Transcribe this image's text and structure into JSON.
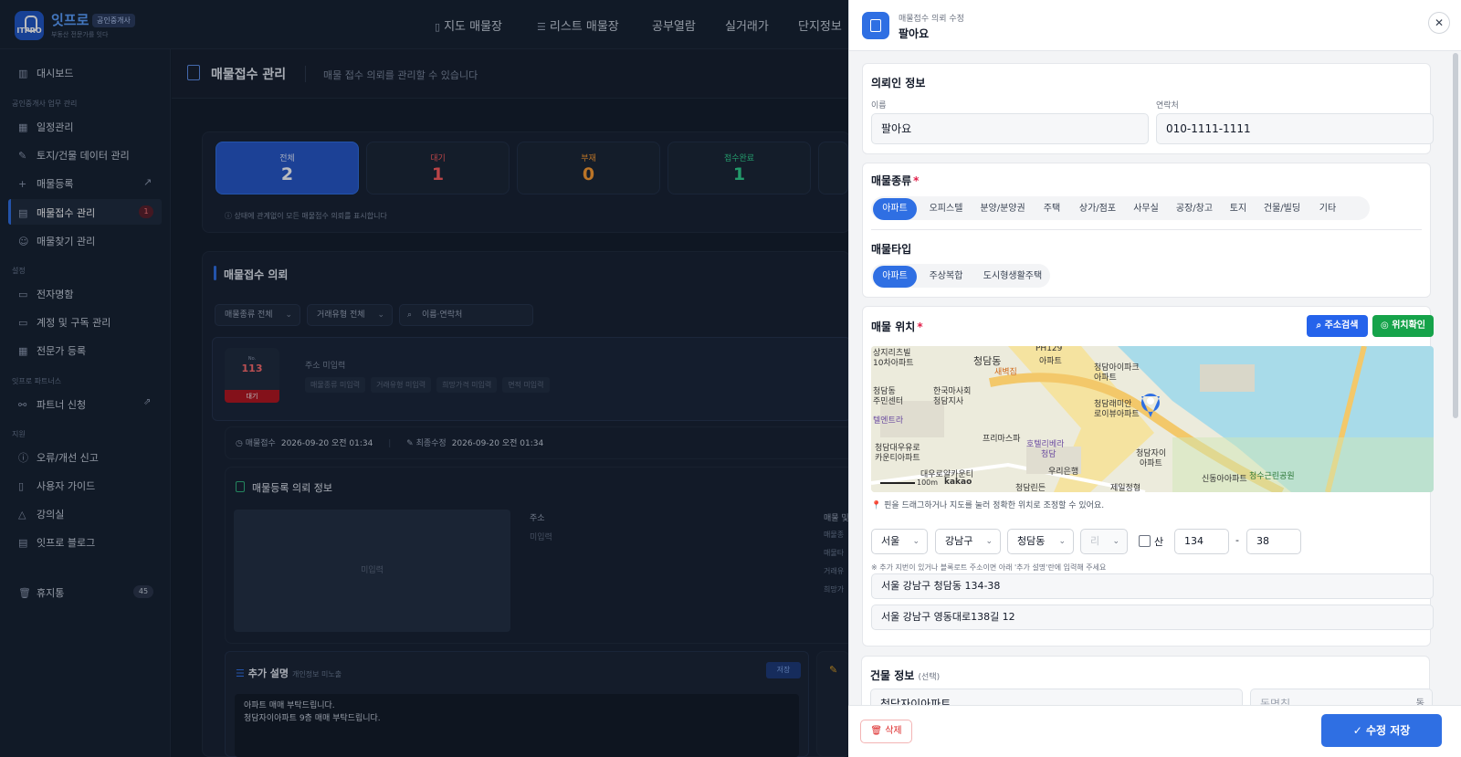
{
  "brand": {
    "name": "잇프로",
    "badge": "공인중개사",
    "tagline": "부동산 전문가를 잇다",
    "logo_text": "ITPRO"
  },
  "nav": [
    {
      "label": "지도 매물장",
      "icon": "map-icon"
    },
    {
      "label": "리스트 매물장",
      "icon": "list-icon"
    },
    {
      "label": "공부열람",
      "icon": ""
    },
    {
      "label": "실거래가",
      "icon": ""
    },
    {
      "label": "단지정보",
      "icon": ""
    }
  ],
  "sidebar": {
    "dashboard": "대시보드",
    "section_work": "공인중개사 업무 관리",
    "items": [
      "일정관리",
      "토지/건물 데이터 관리",
      "매물등록",
      "매물접수 관리",
      "매물찾기 관리"
    ],
    "intake_badge": "1",
    "section_settings": "설정",
    "settings": [
      "전자명함",
      "계정 및 구독 관리",
      "전문가 등록"
    ],
    "section_partners": "잇프로 파트너스",
    "partner": "파트너 신청",
    "section_support": "지원",
    "support": [
      "오류/개선 신고",
      "사용자 가이드",
      "강의실",
      "잇프로 블로그"
    ],
    "trash": "휴지통",
    "trash_badge": "45"
  },
  "page": {
    "title": "매물접수 관리",
    "subtitle": "매물 접수 의뢰를 관리할 수 있습니다"
  },
  "stats": [
    {
      "label": "전체",
      "value": "2",
      "color": "#ffffff"
    },
    {
      "label": "대기",
      "value": "1",
      "color": "#ff5a5a"
    },
    {
      "label": "부재",
      "value": "0",
      "color": "#ff9d2e"
    },
    {
      "label": "접수완료",
      "value": "1",
      "color": "#2fd28c"
    }
  ],
  "stats_note": "상태에 관계없이 모든 매물접수 의뢰를 표시합니다",
  "list": {
    "title": "매물접수 의뢰",
    "filter_type": "매물종류 전체",
    "filter_deal": "거래유형 전체",
    "search_placeholder": "이름·연락처"
  },
  "request_card": {
    "no_label": "No.",
    "no": "113",
    "status": "대기",
    "addr_title": "주소 미입력",
    "chips": [
      "매물종류 미입력",
      "거래유형 미입력",
      "희망가격 미입력",
      "면적 미입력"
    ]
  },
  "dates": {
    "received_label": "매물접수",
    "received": "2026-09-20 오전 01:34",
    "modified_label": "최종수정",
    "modified": "2026-09-20 오전 01:34"
  },
  "detail": {
    "title": "매물등록 의뢰 정보",
    "no_image": "미입력",
    "addr_label": "주소",
    "addr_value": "미입력",
    "right_label": "매물 및",
    "right_items": [
      "매물종",
      "매물타",
      "거래유",
      "희망가"
    ]
  },
  "extra": {
    "title": "추가 설명",
    "sub": "개인정보 미노출",
    "save": "저장",
    "text_lines": [
      "아파트 매매 부탁드립니다.",
      "청담자이아파트 9층 매매 부탁드립니다."
    ]
  },
  "drawer": {
    "subtitle": "매물접수 의뢰 수정",
    "title": "팔아요",
    "requester": {
      "title": "의뢰인 정보",
      "name_label": "이름",
      "name": "팔아요",
      "phone_label": "연락처",
      "phone": "010-1111-1111"
    },
    "type": {
      "title": "매물종류",
      "options": [
        "아파트",
        "오피스텔",
        "분양/분양권",
        "주택",
        "상가/점포",
        "사무실",
        "공장/창고",
        "토지",
        "건물/빌딩",
        "기타"
      ],
      "selected": "아파트"
    },
    "subtype": {
      "title": "매물타입",
      "options": [
        "아파트",
        "주상복합",
        "도시형생활주택"
      ],
      "selected": "아파트"
    },
    "location": {
      "title": "매물 위치",
      "search_btn": "주소검색",
      "confirm_btn": "위치확인",
      "hint": "핀을 드래그하거나 지도를 눌러 정확한 위치로 조정할 수 있어요.",
      "sido": "서울",
      "gu": "강남구",
      "dong": "청담동",
      "ri": "리",
      "san": "산",
      "bunji1": "134",
      "bunji2": "38",
      "dash": "-",
      "note": "※ 추가 지번이 있거나 블록로트 주소이면 아래 '추가 설명'란에 입력해 주세요",
      "jibun": "서울 강남구 청담동 134-38",
      "road": "서울 강남구 영동대로138길 12"
    },
    "map_labels": [
      "상지리츠빌",
      "10차아파트",
      "청담동",
      "PH129",
      "아파트",
      "새벽집",
      "청담아이파크",
      "아파트",
      "청담동",
      "주민센터",
      "한국마사회",
      "청담지사",
      "청담래미안",
      "로이뷰아파트",
      "텔엔트라",
      "프리마스파",
      "호텔리베라",
      "청담",
      "청담대우유로",
      "카운티아파트",
      "청담자이",
      "아파트",
      "대우로얄카운티",
      "우리은행",
      "신동아아파트",
      "청수근린공원",
      "청담린든",
      "제일정형",
      "100m",
      "kakao"
    ],
    "building": {
      "title": "건물 정보",
      "optional": "(선택)",
      "name": "청담자이아파트",
      "dong_placeholder": "동명칭",
      "dong_suffix": "동"
    },
    "delete_btn": "삭제",
    "save_btn": "수정 저장"
  },
  "colors": {
    "accent": "#2f6fe3",
    "green": "#16a34a",
    "danger": "#dc2626"
  }
}
